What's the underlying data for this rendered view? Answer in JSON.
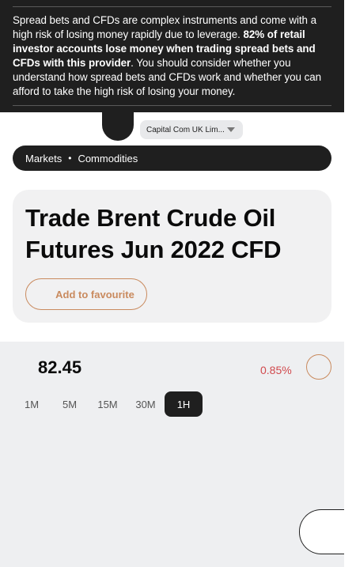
{
  "risk_warning": {
    "text_before": "Spread bets and CFDs are complex instruments and come with a high risk of losing money rapidly due to leverage. ",
    "text_bold": "82% of retail investor accounts lose money when trading spread bets and CFDs with this provider",
    "text_after": ". You should consider whether you understand how spread bets and CFDs work and whether you can afford to take the high risk of losing your money."
  },
  "entity_select": {
    "value": "Capital Com UK Lim..."
  },
  "breadcrumb": {
    "items": [
      "Markets",
      "Commodities"
    ],
    "separator": "•"
  },
  "instrument": {
    "title": "Trade Brent Crude Oil Futures Jun 2022 CFD",
    "favourite_label": "Add to favourite"
  },
  "quote": {
    "price": "82.45",
    "change": "0.85%",
    "change_color": "#d1494d"
  },
  "timeframes": {
    "items": [
      "1M",
      "5M",
      "15M",
      "30M",
      "1H"
    ],
    "selected": "1H"
  },
  "colors": {
    "dark": "#1f1f1f",
    "accent": "#c98a5e",
    "panel": "#f1f1f2"
  }
}
